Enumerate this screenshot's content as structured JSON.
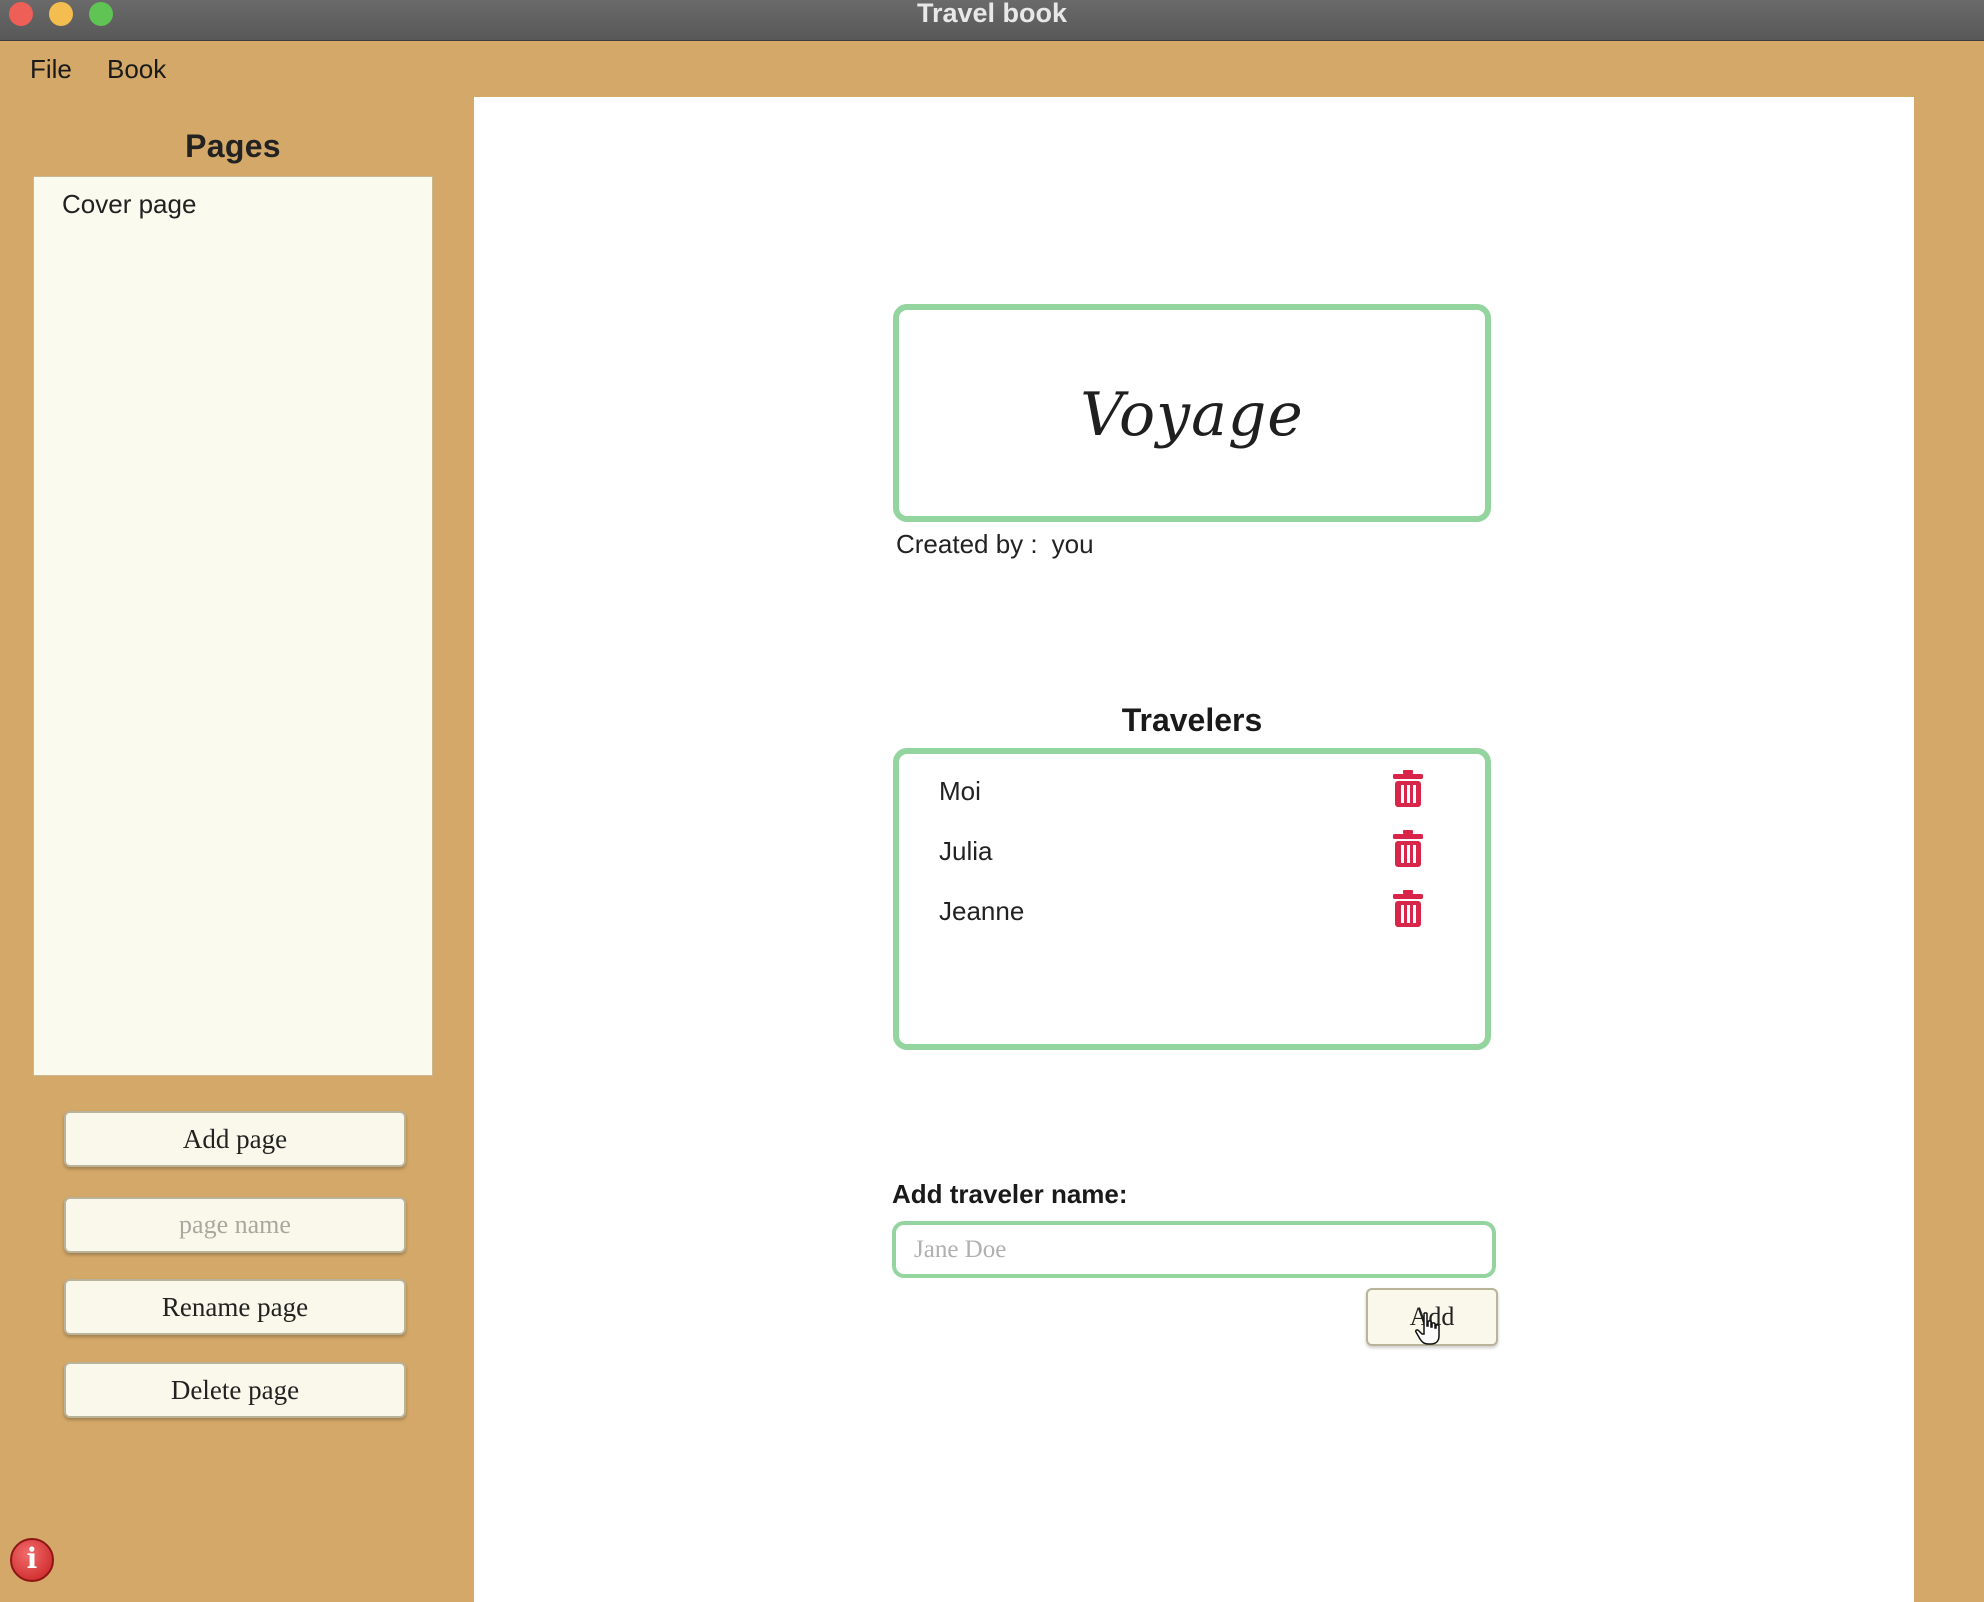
{
  "window": {
    "title": "Travel book"
  },
  "menu": {
    "file": "File",
    "book": "Book"
  },
  "sidebar": {
    "title": "Pages",
    "pages": [
      "Cover page"
    ],
    "add_button": "Add page",
    "page_name_placeholder": "page name",
    "rename_button": "Rename page",
    "delete_button": "Delete page"
  },
  "cover": {
    "book_title": "Voyage",
    "created_by_label": "Created by :",
    "created_by_value": "you"
  },
  "travelers": {
    "title": "Travelers",
    "items": [
      "Moi",
      "Julia",
      "Jeanne"
    ],
    "add_label": "Add traveler name:",
    "add_placeholder": "Jane Doe",
    "add_button": "Add"
  },
  "colors": {
    "background": "#d4a868",
    "panel": "#fafaef",
    "accent_border": "#93d49f",
    "delete_icon": "#d7264a"
  },
  "icons": {
    "info": "info-icon",
    "delete": "trash-icon",
    "cursor": "hand-cursor-icon"
  }
}
